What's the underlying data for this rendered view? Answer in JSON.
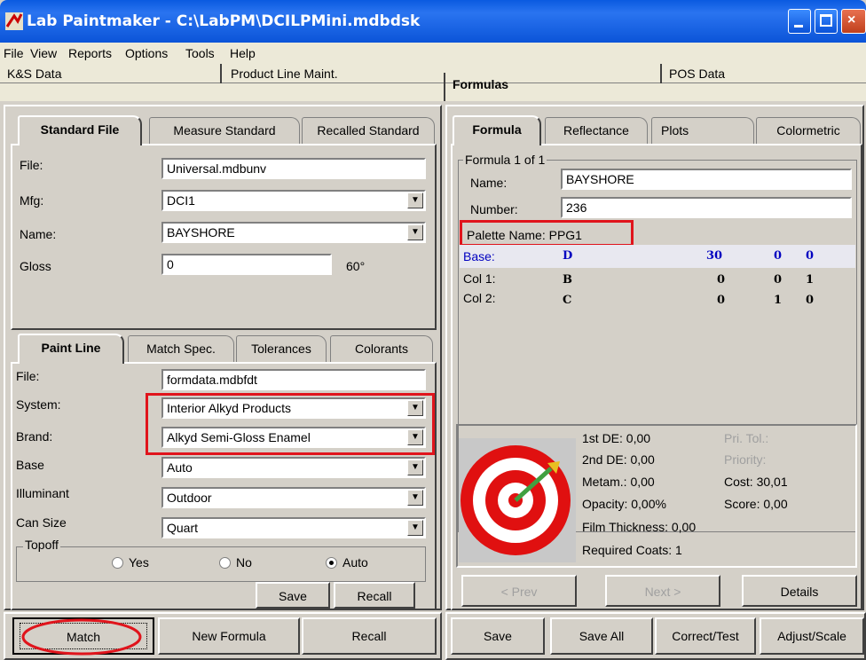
{
  "window": {
    "title": "Lab Paintmaker - C:\\LabPM\\DCILPMini.mdbdsk"
  },
  "menu": [
    "File",
    "View",
    "Reports",
    "Options",
    "Tools",
    "Help"
  ],
  "top_tabs": [
    "K&S Data",
    "Product Line Maint.",
    "Formulas",
    "POS Data"
  ],
  "standard": {
    "tabs": [
      "Standard File",
      "Measure Standard",
      "Recalled Standard"
    ],
    "file_label": "File:",
    "file_value": "Universal.mdbunv",
    "mfg_label": "Mfg:",
    "mfg_value": "DCI1",
    "name_label": "Name:",
    "name_value": "BAYSHORE",
    "gloss_label": "Gloss",
    "gloss_value": "0",
    "gloss_angle": "60°"
  },
  "paintline": {
    "tabs": [
      "Paint Line",
      "Match Spec.",
      "Tolerances",
      "Colorants"
    ],
    "file_label": "File:",
    "file_value": "formdata.mdbfdt",
    "system_label": "System:",
    "system_value": "Interior Alkyd Products",
    "brand_label": "Brand:",
    "brand_value": "Alkyd Semi-Gloss Enamel",
    "base_label": "Base",
    "base_value": "Auto",
    "illum_label": "Illuminant",
    "illum_value": "Outdoor",
    "can_label": "Can Size",
    "can_value": "Quart",
    "topoff_label": "Topoff",
    "yes": "Yes",
    "no": "No",
    "auto": "Auto",
    "topoff_selected": "Auto",
    "save": "Save",
    "recall": "Recall"
  },
  "formula": {
    "tabs": [
      "Formula",
      "Reflectance",
      "Plots",
      "Colormetric"
    ],
    "count": "Formula 1 of 1",
    "name_label": "Name:",
    "name_value": "BAYSHORE",
    "number_label": "Number:",
    "number_value": "236",
    "palette": "Palette Name:  PPG1",
    "rows": [
      {
        "label": "Base:",
        "code": "D",
        "a": "30",
        "b": "0",
        "c": "0"
      },
      {
        "label": "Col 1:",
        "code": "B",
        "a": "0",
        "b": "0",
        "c": "1"
      },
      {
        "label": "Col 2:",
        "code": "C",
        "a": "0",
        "b": "1",
        "c": "0"
      }
    ]
  },
  "stats": {
    "de1": "1st DE: 0,00",
    "de2": "2nd DE: 0,00",
    "metam": "Metam.: 0,00",
    "opacity": "Opacity: 0,00%",
    "film": "Film Thickness: 0,00",
    "coats": "Required Coats: 1",
    "pritol": "Pri. Tol.:",
    "priority": "Priority:",
    "cost": "Cost: 30,01",
    "score": "Score: 0,00"
  },
  "nav": {
    "prev": "< Prev",
    "next": "Next >",
    "details": "Details"
  },
  "bottom_left": {
    "match": "Match",
    "new_formula": "New Formula",
    "recall": "Recall"
  },
  "bottom_right": {
    "save": "Save",
    "save_all": "Save All",
    "correct": "Correct/Test",
    "adjust": "Adjust/Scale"
  },
  "colors": {
    "highlight": "#e0141c",
    "base_row": "#0000c0"
  }
}
